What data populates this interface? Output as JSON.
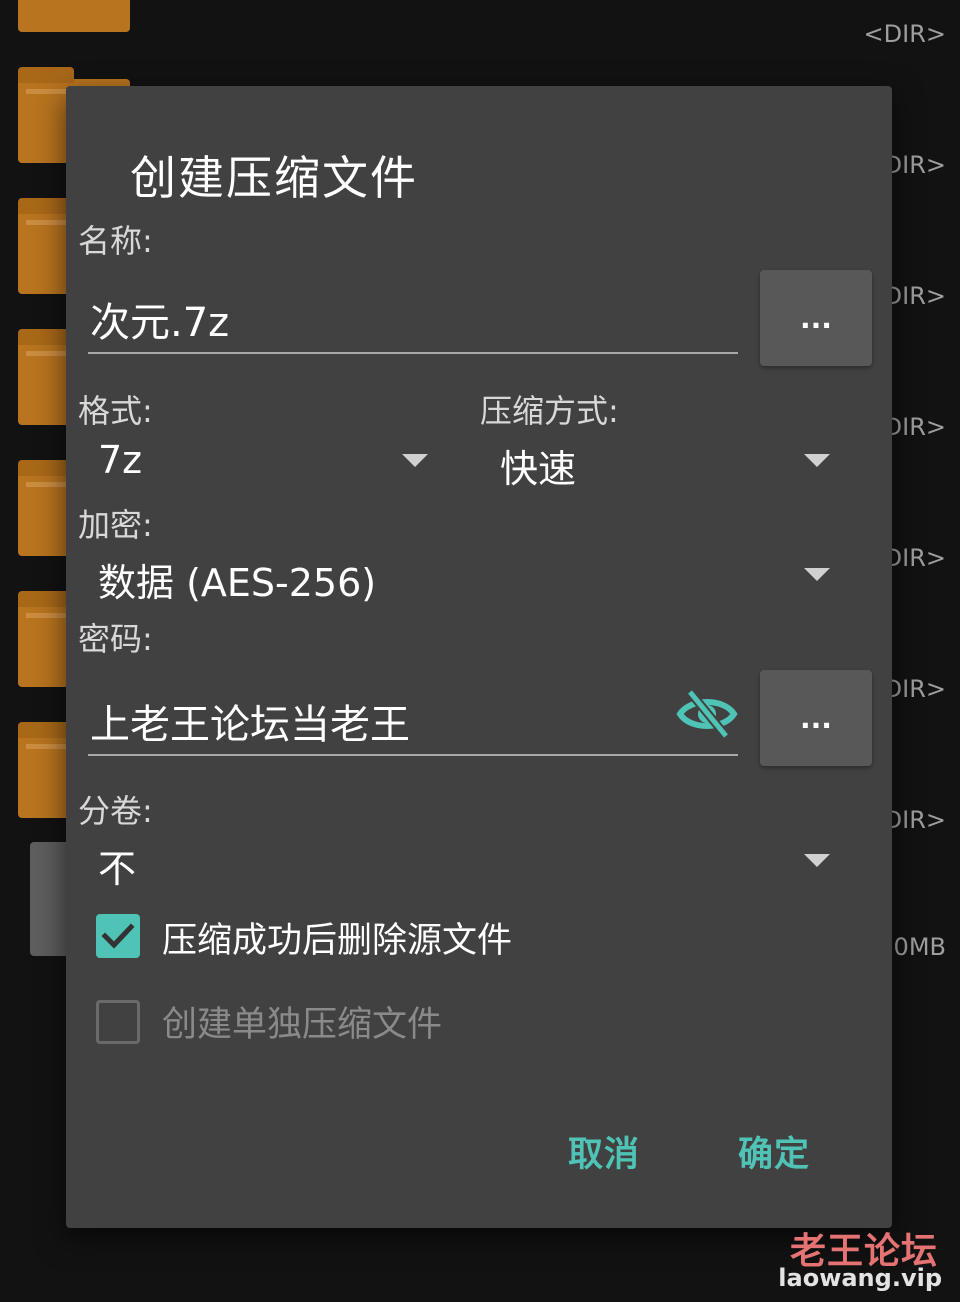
{
  "background": {
    "rows": [
      {
        "meta": "<DIR>"
      },
      {
        "meta": "DIR>"
      },
      {
        "meta": "DIR>"
      },
      {
        "meta": "DIR>"
      },
      {
        "meta": "DIR>"
      },
      {
        "meta": "DIR>"
      },
      {
        "meta": "DIR>"
      },
      {
        "meta": "0MB"
      }
    ]
  },
  "dialog": {
    "title": "创建压缩文件",
    "name_label": "名称:",
    "name_value": "次元.7z",
    "name_browse": "...",
    "format_label": "格式:",
    "format_value": "7z",
    "method_label": "压缩方式:",
    "method_value": "快速",
    "encryption_label": "加密:",
    "encryption_value": "数据 (AES-256)",
    "password_label": "密码:",
    "password_value": "上老王论坛当老王",
    "password_browse": "...",
    "split_label": "分卷:",
    "split_value": "不",
    "delete_source_label": "压缩成功后删除源文件",
    "delete_source_checked": true,
    "separate_archives_label": "创建单独压缩文件",
    "separate_archives_checked": false,
    "cancel_label": "取消",
    "ok_label": "确定"
  },
  "colors": {
    "accent": "#4fc3b5",
    "dialog_bg": "#414141",
    "folder": "#b8741f"
  },
  "icons": {
    "visibility_toggle": "eye-off-icon",
    "checked": "check-icon"
  },
  "watermark": {
    "logo": "老王论坛",
    "url": "laowang.vip"
  }
}
